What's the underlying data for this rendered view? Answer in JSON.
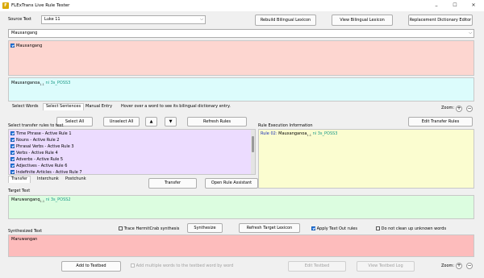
{
  "window": {
    "title": "FLExTrans Live Rule Tester",
    "minimize": "–",
    "maximize": "☐",
    "close": "✕",
    "icon_text": "F"
  },
  "source": {
    "label": "Source Text",
    "selected_text": "Luke 11"
  },
  "top_buttons": {
    "rebuild": "Rebuild Bilingual Lexicon",
    "view": "View Bilingual Lexicon",
    "replacement": "Replacement Dictionary Editor"
  },
  "sentence_combo": {
    "value": "Mauxangang"
  },
  "selected_words": [
    {
      "text": "Mauxangang",
      "checked": true
    }
  ],
  "lexical_unit": {
    "word": "Mauxanganoa",
    "sense": "1.1",
    "tag": "ni 3s_POSS3"
  },
  "tabs": {
    "words": "Select Words",
    "sentences": "Select Sentences",
    "manual": "Manual Entry",
    "hint": "Hover over a word to see its bilingual dictionary entry."
  },
  "zoom": {
    "label": "Zoom:",
    "plus": "+",
    "minus": "−"
  },
  "rules": {
    "label": "Select transfer rules to test",
    "select_all": "Select All",
    "unselect_all": "Unselect All",
    "up": "▲",
    "down": "▼",
    "refresh": "Refresh Rules",
    "items": [
      {
        "label": "Time Phrase - Active Rule 1",
        "checked": true
      },
      {
        "label": "Nouns - Active Rule 2",
        "checked": true
      },
      {
        "label": "Phrasal Verbs - Active Rule 3",
        "checked": true
      },
      {
        "label": "Verbs - Active Rule 4",
        "checked": true
      },
      {
        "label": "Adverbs - Active Rule 5",
        "checked": true
      },
      {
        "label": "Adjectives - Active Rule 6",
        "checked": true
      },
      {
        "label": "Indefinite Articles - Active Rule 7",
        "checked": true
      }
    ],
    "tabs": [
      "Transfer",
      "Interchunk",
      "Postchunk"
    ]
  },
  "execution": {
    "label": "Rule Execution Information",
    "edit": "Edit Transfer Rules",
    "rule": "Rule 02:",
    "word": "Mauxanganoa",
    "sense": "1.1",
    "tag": "ni 3s_POSS3"
  },
  "transfer": {
    "button": "Transfer",
    "assistant": "Open Rule Assistant"
  },
  "target": {
    "label": "Target Text",
    "word": "Maruwanganq",
    "sense": "1.1",
    "tag": "ni 3s_POSS2"
  },
  "synthesis": {
    "label": "Synthesized Text",
    "trace": "Trace HermitCrab synthesis",
    "synthesize": "Synthesize",
    "refresh_target": "Refresh Target Lexicon",
    "apply_textout": "Apply Text Out rules",
    "no_cleanup": "Do not clean up unknown words",
    "result": "Maruwangan"
  },
  "bottom": {
    "add": "Add to Testbed",
    "multiple": "Add multiple words to the testbed word by word",
    "edit": "Edit Testbed",
    "view": "View Testbed Log"
  }
}
